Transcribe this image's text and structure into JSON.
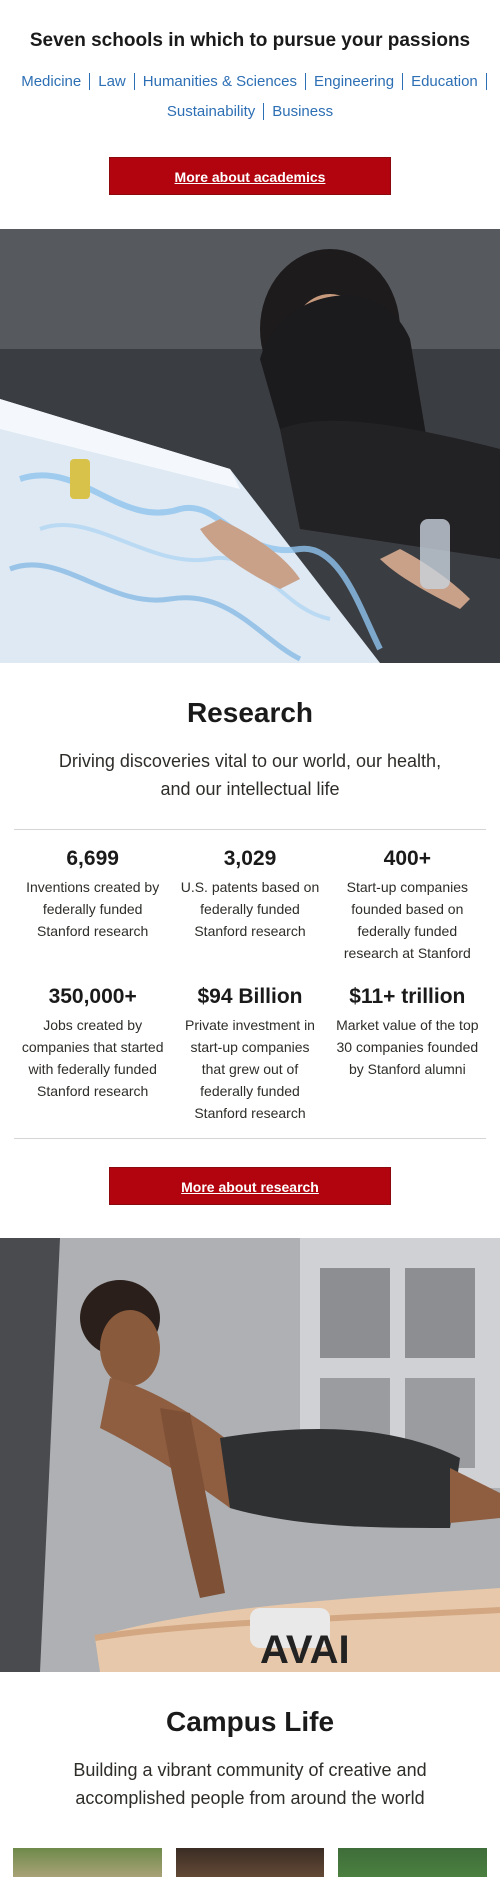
{
  "schools": {
    "title": "Seven schools in which to pursue your passions",
    "links": [
      "Medicine",
      "Law",
      "Humanities & Sciences",
      "Engineering",
      "Education",
      "Sustainability",
      "Business"
    ],
    "button": "More about academics"
  },
  "research": {
    "title": "Research",
    "subtitle": "Driving discoveries vital to our world, our health, and our intellectual life",
    "stats": [
      {
        "num": "6,699",
        "desc": "Inventions created by federally funded Stanford research"
      },
      {
        "num": "3,029",
        "desc": "U.S. patents based on federally funded Stanford research"
      },
      {
        "num": "400+",
        "desc": "Start-up companies founded based on federally funded research at Stanford"
      },
      {
        "num": "350,000+",
        "desc": "Jobs created by companies that started with federally funded Stanford research"
      },
      {
        "num": "$94 Billion",
        "desc": "Private investment in start-up companies that grew out of federally funded Stanford research"
      },
      {
        "num": "$11+ trillion",
        "desc": "Market value of the top 30 companies founded by Stanford alumni"
      }
    ],
    "button": "More about research"
  },
  "campus": {
    "title": "Campus Life",
    "subtitle": "Building a vibrant community of creative and accomplished people from around the world"
  },
  "pommel_text": "AVAI"
}
